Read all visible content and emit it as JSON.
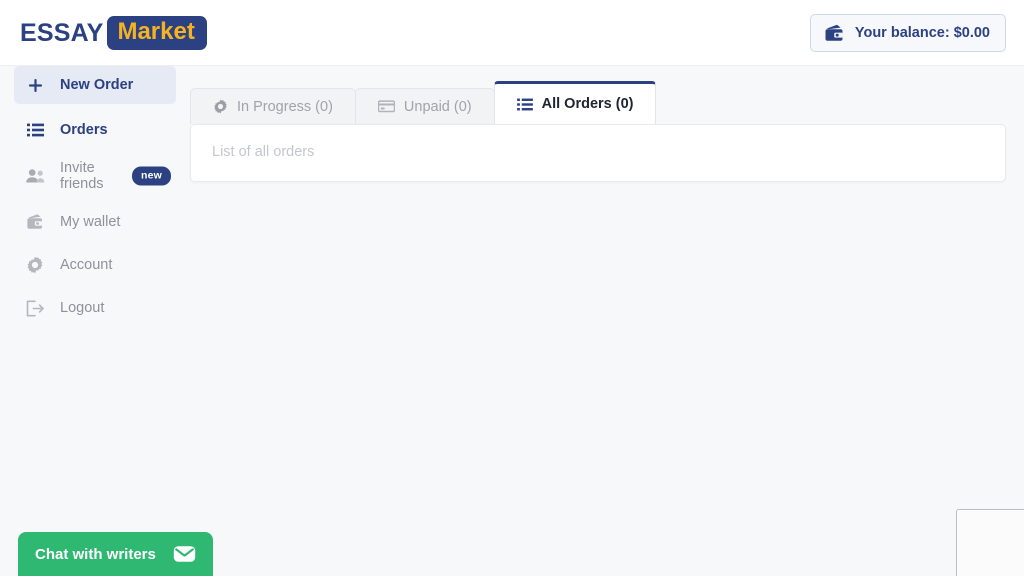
{
  "header": {
    "logo_primary": "ESSAY",
    "logo_secondary": "Market",
    "balance_label": "Your balance: $0.00",
    "balance_icon": "wallet-icon"
  },
  "sidebar": {
    "items": [
      {
        "label": "New Order",
        "icon": "plus-icon",
        "state": "active",
        "badge": null
      },
      {
        "label": "Orders",
        "icon": "list-icon",
        "state": "strong",
        "badge": null
      },
      {
        "label": "Invite friends",
        "icon": "people-icon",
        "state": "default",
        "badge": "new"
      },
      {
        "label": "My wallet",
        "icon": "wallet-icon",
        "state": "default",
        "badge": null
      },
      {
        "label": "Account",
        "icon": "gear-icon",
        "state": "default",
        "badge": null
      },
      {
        "label": "Logout",
        "icon": "logout-icon",
        "state": "default",
        "badge": null
      }
    ]
  },
  "main": {
    "tabs": [
      {
        "label": "In Progress (0)",
        "icon": "gear-icon",
        "active": false
      },
      {
        "label": "Unpaid (0)",
        "icon": "card-icon",
        "active": false
      },
      {
        "label": "All Orders (0)",
        "icon": "list-icon",
        "active": true
      }
    ],
    "panel_text": "List of all orders"
  },
  "chat": {
    "button_label": "Chat with writers",
    "button_icon": "envelope-icon"
  },
  "colors": {
    "brand_blue": "#2c4182",
    "brand_gold": "#f5b324",
    "chat_green": "#2eb872",
    "muted_text": "#8e9199",
    "page_bg": "#f7f8fa"
  }
}
